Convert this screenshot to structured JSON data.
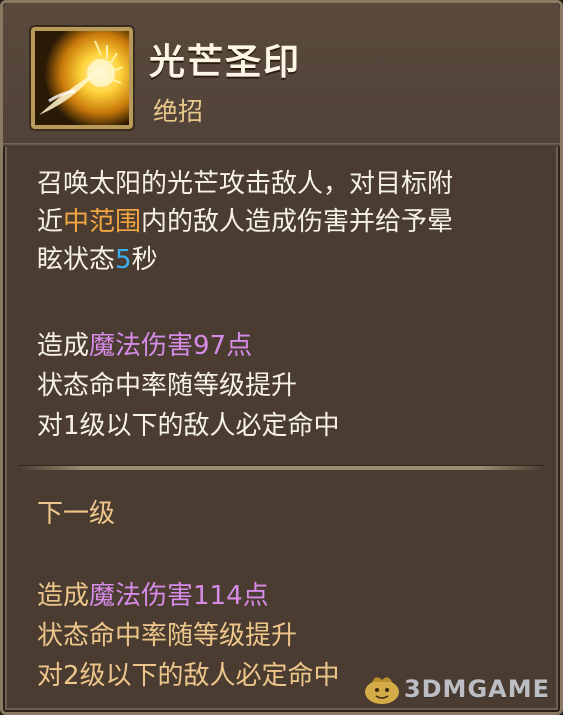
{
  "skill": {
    "name": "光芒圣印",
    "type": "绝招",
    "icon": "sun-slash-icon"
  },
  "description": {
    "line1": "召唤太阳的光芒攻击敌人，对目标附",
    "line2_prefix": "近",
    "line2_highlight": "中范围",
    "line2_suffix": "内的敌人造成伤害并给予晕",
    "line3_prefix": "眩状态",
    "line3_highlight": "5",
    "line3_suffix": "秒"
  },
  "current": {
    "damage_prefix": "造成",
    "damage_highlight": "魔法伤害97点",
    "line2": "状态命中率随等级提升",
    "line3": "对1级以下的敌人必定命中"
  },
  "next_level": {
    "title": "下一级",
    "damage_prefix": "造成",
    "damage_highlight": "魔法伤害114点",
    "line2": "状态命中率随等级提升",
    "line3": "对2级以下的敌人必定命中"
  },
  "watermark": {
    "text": "3DMGAME"
  },
  "colors": {
    "panel": "#4a3c31",
    "border": "#8a7a63",
    "title": "#fdf6e6",
    "type": "#e8c78a",
    "orange_highlight": "#f2a540",
    "blue_highlight": "#3ab0ef",
    "purple_highlight": "#d68be7",
    "next_level_text": "#eec68b"
  }
}
